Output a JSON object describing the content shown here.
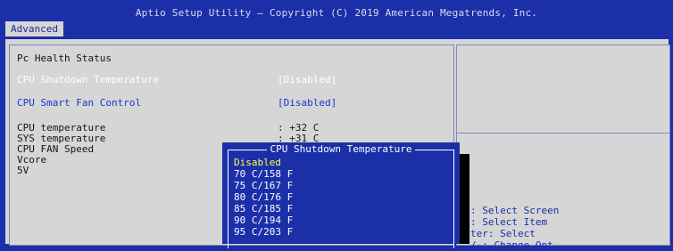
{
  "header": {
    "title": "Aptio Setup Utility – Copyright (C) 2019 American Megatrends, Inc.",
    "tab": "Advanced"
  },
  "main": {
    "section_title": "Pc Health Status",
    "shutdown": {
      "label": "CPU Shutdown Temperature",
      "value": "[Disabled]"
    },
    "fan": {
      "label": "CPU Smart Fan Control",
      "value": "[Disabled]"
    },
    "readings": [
      {
        "label": "CPU temperature",
        "value": ": +32 C"
      },
      {
        "label": "SYS temperature",
        "value": ": +31 C"
      },
      {
        "label": "CPU FAN Speed",
        "value": ""
      },
      {
        "label": "Vcore",
        "value": ""
      },
      {
        "label": "5V",
        "value": ""
      }
    ]
  },
  "popup": {
    "title": "CPU Shutdown Temperature",
    "options": [
      "Disabled",
      "70 C/158 F",
      "75 C/167 F",
      "80 C/176 F",
      "85 C/185 F",
      "90 C/194 F",
      "95 C/203 F"
    ],
    "selected_index": 0
  },
  "help": {
    "lines": [
      ": Select Screen",
      ": Select Item",
      "ter: Select",
      "/-: Change Opt."
    ]
  },
  "colors": {
    "background": "#1b2fa8",
    "panel": "#d6d6d6",
    "highlight": "#ffffff",
    "selected": "#ffff4a"
  }
}
